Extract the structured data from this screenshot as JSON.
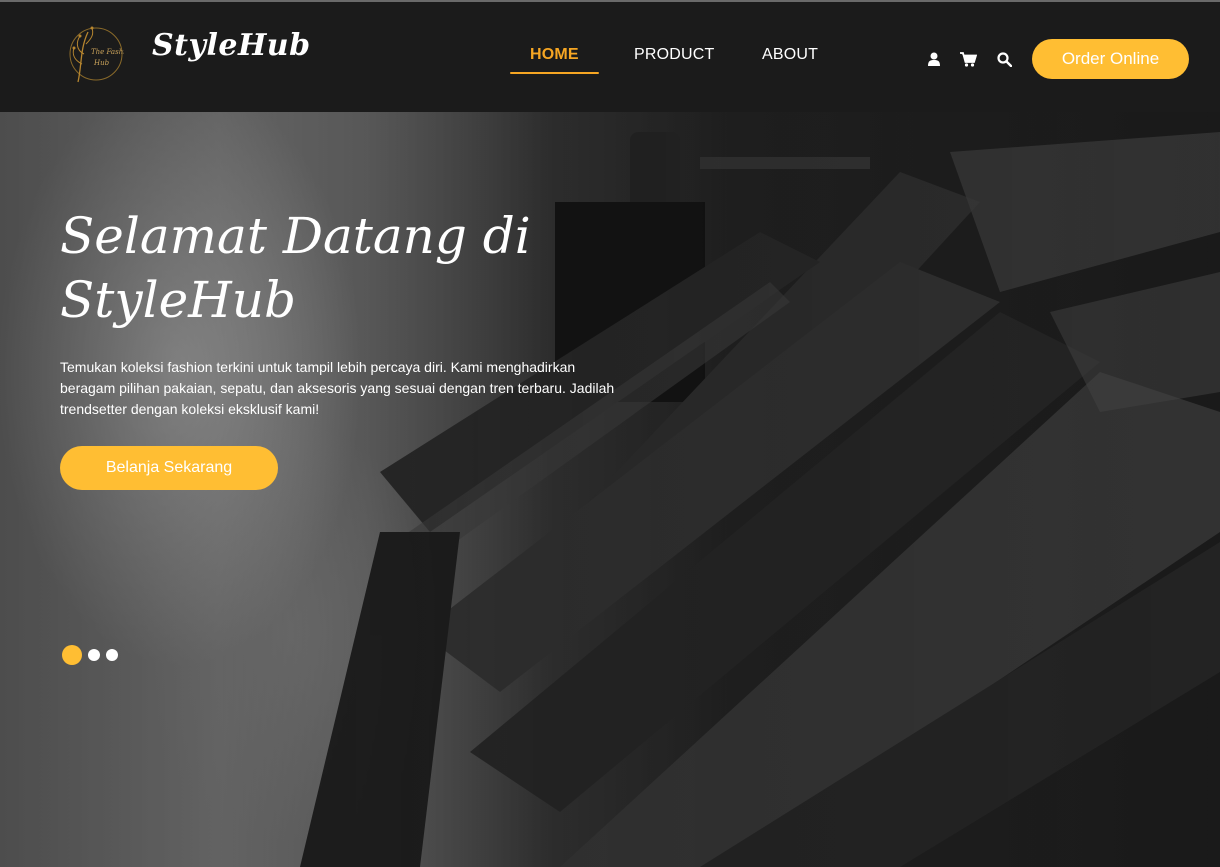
{
  "header": {
    "brand": "StyleHub",
    "logo_text": [
      "The Fashion",
      "Hub"
    ],
    "nav": [
      {
        "label": "HOME",
        "active": true
      },
      {
        "label": "PRODUCT",
        "active": false
      },
      {
        "label": "ABOUT",
        "active": false
      }
    ],
    "icons": [
      "user-icon",
      "cart-icon",
      "search-icon"
    ],
    "order_button": "Order Online"
  },
  "hero": {
    "title_line1": "Selamat Datang di",
    "title_line2": "StyleHub",
    "description": "Temukan koleksi fashion terkini untuk tampil lebih percaya diri. Kami menghadirkan beragam pilihan pakaian, sepatu, dan aksesoris yang sesuai dengan tren terbaru. Jadilah trendsetter dengan koleksi eksklusif kami!",
    "cta_button": "Belanja Sekarang",
    "slides_count": 3,
    "active_slide": 1
  },
  "colors": {
    "accent": "#ffbe33",
    "nav_active": "#f6a623",
    "header_bg": "#1b1b1b"
  }
}
